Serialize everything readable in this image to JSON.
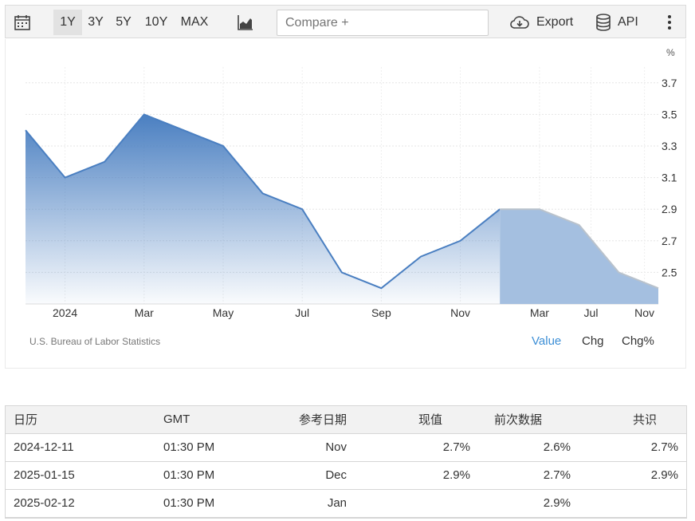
{
  "toolbar": {
    "ranges": [
      "1Y",
      "3Y",
      "5Y",
      "10Y",
      "MAX"
    ],
    "active_range": "1Y",
    "compare_placeholder": "Compare +",
    "export_label": "Export",
    "api_label": "API"
  },
  "chart_data": {
    "type": "area",
    "unit_label": "%",
    "y_ticks": [
      2.5,
      2.7,
      2.9,
      3.1,
      3.3,
      3.5,
      3.7
    ],
    "ylim": [
      2.3,
      3.8
    ],
    "x_tick_labels": [
      "2024",
      "Mar",
      "May",
      "Jul",
      "Sep",
      "Nov",
      "Mar",
      "Jul",
      "Nov"
    ],
    "series": [
      {
        "values": [
          3.4,
          3.1,
          3.2,
          3.5,
          3.4,
          3.3,
          3.0,
          2.9,
          2.5,
          2.4,
          2.6,
          2.7,
          2.9
        ]
      },
      {
        "values": [
          2.9,
          2.9,
          2.8,
          2.5,
          2.4
        ]
      }
    ],
    "grid": true,
    "colors": {
      "actual": "#4a7fc1",
      "forecast_fill": "#a4bfe0",
      "forecast_line": "#b9c2cc"
    }
  },
  "source": "U.S. Bureau of Labor Statistics",
  "modes": [
    "Value",
    "Chg",
    "Chg%"
  ],
  "active_mode": "Value",
  "table": {
    "headers": [
      "日历",
      "GMT",
      "参考日期",
      "现值",
      "前次数据",
      "共识"
    ],
    "rows": [
      [
        "2024-12-11",
        "01:30 PM",
        "Nov",
        "2.7%",
        "2.6%",
        "2.7%"
      ],
      [
        "2025-01-15",
        "01:30 PM",
        "Dec",
        "2.9%",
        "2.7%",
        "2.9%"
      ],
      [
        "2025-02-12",
        "01:30 PM",
        "Jan",
        "",
        "2.9%",
        ""
      ]
    ]
  },
  "accent_color": "#3d8fd6"
}
